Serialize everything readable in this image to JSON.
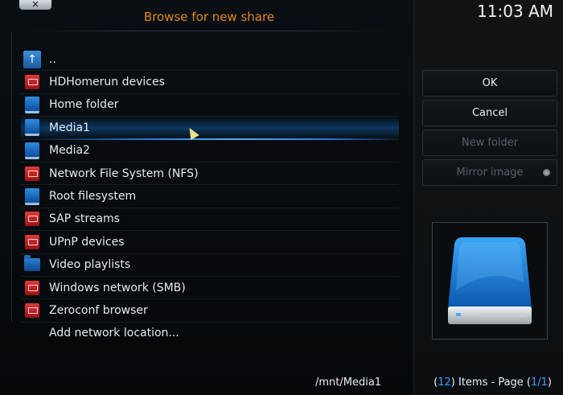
{
  "dialog": {
    "title": "Browse for new share",
    "close_symbol": "×"
  },
  "clock": {
    "time": "11:03 AM"
  },
  "list": {
    "items": [
      {
        "label": "..",
        "icon": "up-arrow-icon"
      },
      {
        "label": "HDHomerun devices",
        "icon": "red-network-icon"
      },
      {
        "label": "Home folder",
        "icon": "blue-drive-icon"
      },
      {
        "label": "Media1",
        "icon": "blue-drive-icon",
        "selected": true
      },
      {
        "label": "Media2",
        "icon": "blue-drive-icon"
      },
      {
        "label": "Network File System (NFS)",
        "icon": "red-network-icon"
      },
      {
        "label": "Root filesystem",
        "icon": "blue-drive-icon"
      },
      {
        "label": "SAP streams",
        "icon": "red-network-icon"
      },
      {
        "label": "UPnP devices",
        "icon": "red-network-icon"
      },
      {
        "label": "Video playlists",
        "icon": "blue-folder-icon"
      },
      {
        "label": "Windows network (SMB)",
        "icon": "red-network-icon"
      },
      {
        "label": "Zeroconf browser",
        "icon": "red-network-icon"
      },
      {
        "label": "Add network location...",
        "icon": ""
      }
    ]
  },
  "buttons": {
    "ok": "OK",
    "cancel": "Cancel",
    "new_folder": "New folder",
    "mirror_image": "Mirror image"
  },
  "footer": {
    "path": "/mnt/Media1",
    "items_open": "(",
    "items_count": "12",
    "items_mid": ") Items - Page (",
    "page": "1/1",
    "items_close": ")"
  },
  "colors": {
    "title": "#e08a1c",
    "accent": "#3aa0ff",
    "selection": "#1e7fe0"
  }
}
